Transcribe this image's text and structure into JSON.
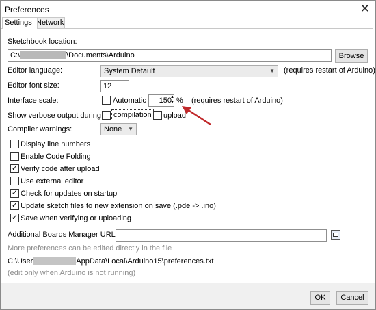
{
  "window": {
    "title": "Preferences",
    "close_glyph": "✕"
  },
  "tabs": [
    {
      "label": "Settings",
      "active": true
    },
    {
      "label": "Network",
      "active": false
    }
  ],
  "sketchbook": {
    "label": "Sketchbook location:",
    "path_prefix": "C:\\",
    "path_suffix": "\\Documents\\Arduino",
    "browse_label": "Browse"
  },
  "editor_language": {
    "label": "Editor language:",
    "value": "System Default",
    "note": "(requires restart of Arduino)"
  },
  "editor_font_size": {
    "label": "Editor font size:",
    "value": "12"
  },
  "interface_scale": {
    "label": "Interface scale:",
    "automatic_label": "Automatic",
    "automatic_checked": false,
    "value": "150",
    "unit": "%",
    "note": "(requires restart of Arduino)"
  },
  "verbose_output": {
    "label": "Show verbose output during:",
    "compilation_label": "compilation",
    "compilation_checked": false,
    "upload_label": "upload",
    "upload_checked": false
  },
  "compiler_warnings": {
    "label": "Compiler warnings:",
    "value": "None"
  },
  "checkboxes": [
    {
      "label": "Display line numbers",
      "checked": false
    },
    {
      "label": "Enable Code Folding",
      "checked": false
    },
    {
      "label": "Verify code after upload",
      "checked": true
    },
    {
      "label": "Use external editor",
      "checked": false
    },
    {
      "label": "Check for updates on startup",
      "checked": true
    },
    {
      "label": "Update sketch files to new extension on save (.pde -> .ino)",
      "checked": true
    },
    {
      "label": "Save when verifying or uploading",
      "checked": true
    }
  ],
  "boards_manager": {
    "label": "Additional Boards Manager URLs:",
    "value": ""
  },
  "footer_notes": {
    "more_prefs": "More preferences can be edited directly in the file",
    "prefs_path_prefix": "C:\\User",
    "prefs_path_suffix": "AppData\\Local\\Arduino15\\preferences.txt",
    "edit_note": "(edit only when Arduino is not running)"
  },
  "buttons": {
    "ok": "OK",
    "cancel": "Cancel"
  },
  "colors": {
    "arrow": "#c0282a",
    "blur": "#b9b9b9",
    "note_grey": "#8c8c8c"
  },
  "icons": {
    "boards_urls_button": "window-icon",
    "dropdown": "chevron-down-icon",
    "spinner": "spinner-icon"
  }
}
